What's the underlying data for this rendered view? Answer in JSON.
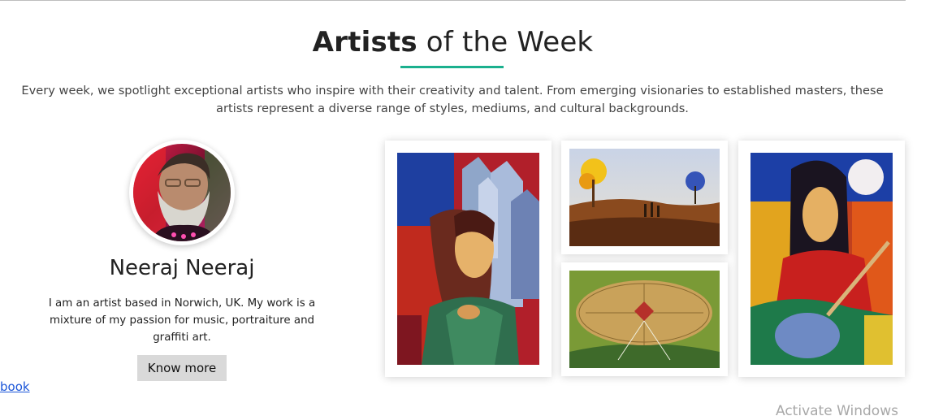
{
  "section": {
    "title_strong": "Artists",
    "title_rest": " of the Week",
    "intro": "Every week, we spotlight exceptional artists who inspire with their creativity and talent. From emerging visionaries to established masters, these artists represent a diverse range of styles, mediums, and cultural backgrounds."
  },
  "artist": {
    "name": "Neeraj Neeraj",
    "bio": "I am an artist based in Norwich, UK. My work is a mixture of my passion for music, portraiture and graffiti art.",
    "cta_label": "Know more",
    "social_link_label": "book"
  },
  "gallery": {
    "artworks": [
      {
        "subject": "woman-with-crystal-shapes-painting"
      },
      {
        "subject": "autumn-landscape-painting"
      },
      {
        "subject": "leaf-kite-painting"
      },
      {
        "subject": "woman-playing-sitar-painting"
      }
    ]
  },
  "system_overlay": {
    "watermark": "Activate Windows"
  },
  "colors": {
    "accent": "#1bb08e",
    "link": "#1a55d8",
    "button_bg": "#d9d9d9"
  }
}
